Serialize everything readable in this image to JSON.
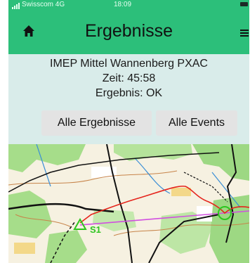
{
  "status_bar": {
    "carrier": "Swisscom",
    "network": "4G",
    "time": "18:09"
  },
  "nav": {
    "title": "Ergebnisse",
    "home_icon": "home-icon",
    "menu_icon": "hamburger-menu-icon"
  },
  "result": {
    "event_name": "IMEP Mittel Wannenberg PXAC",
    "time_text": "Zeit: 45:58",
    "result_text": "Ergebnis: OK"
  },
  "buttons": {
    "all_results": "Alle Ergebnisse",
    "all_events": "Alle Events"
  },
  "map": {
    "start_label": "S1"
  },
  "colors": {
    "brand_green": "#2cbf7a",
    "page_background": "#d9ecea",
    "route_red": "#e5231b",
    "course_magenta": "#d14fe0",
    "map_green": "#79d152"
  }
}
